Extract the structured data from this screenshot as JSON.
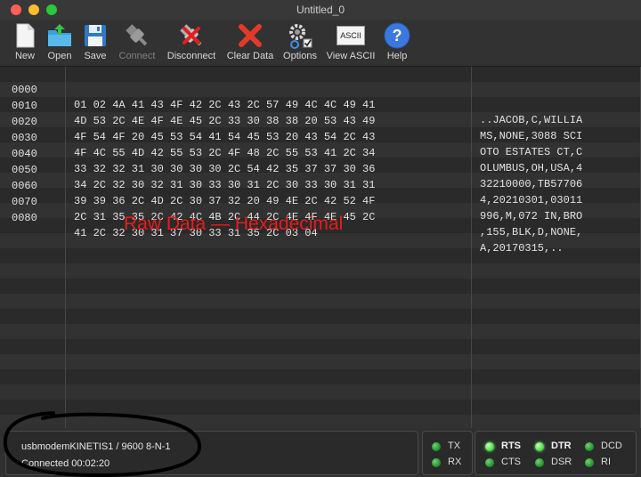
{
  "window": {
    "title": "Untitled_0"
  },
  "toolbar": {
    "new": "New",
    "open": "Open",
    "save": "Save",
    "connect": "Connect",
    "disconnect": "Disconnect",
    "clear": "Clear Data",
    "options": "Options",
    "view_ascii": "View ASCII",
    "view_ascii_icon_text": "ASCII",
    "help": "Help"
  },
  "data_rows": [
    {
      "offset": "0000",
      "hex": "01 02 4A 41 43 4F 42 2C 43 2C 57 49 4C 4C 49 41",
      "ascii": "..JACOB,C,WILLIA"
    },
    {
      "offset": "0010",
      "hex": "4D 53 2C 4E 4F 4E 45 2C 33 30 38 38 20 53 43 49",
      "ascii": "MS,NONE,3088 SCI"
    },
    {
      "offset": "0020",
      "hex": "4F 54 4F 20 45 53 54 41 54 45 53 20 43 54 2C 43",
      "ascii": "OTO ESTATES CT,C"
    },
    {
      "offset": "0030",
      "hex": "4F 4C 55 4D 42 55 53 2C 4F 48 2C 55 53 41 2C 34",
      "ascii": "OLUMBUS,OH,USA,4"
    },
    {
      "offset": "0040",
      "hex": "33 32 32 31 30 30 30 30 2C 54 42 35 37 37 30 36",
      "ascii": "32210000,TB57706"
    },
    {
      "offset": "0050",
      "hex": "34 2C 32 30 32 31 30 33 30 31 2C 30 33 30 31 31",
      "ascii": "4,20210301,03011"
    },
    {
      "offset": "0060",
      "hex": "39 39 36 2C 4D 2C 30 37 32 20 49 4E 2C 42 52 4F",
      "ascii": "996,M,072 IN,BRO"
    },
    {
      "offset": "0070",
      "hex": "2C 31 35 35 2C 42 4C 4B 2C 44 2C 4E 4F 4E 45 2C",
      "ascii": ",155,BLK,D,NONE,"
    },
    {
      "offset": "0080",
      "hex": "41 2C 32 30 31 37 30 33 31 35 2C 03 04",
      "ascii": "A,20170315,.."
    }
  ],
  "overlay_label": "Raw Data — Hexadecimal",
  "status": {
    "port_info": "usbmodemKINETIS1 / 9600 8-N-1",
    "connection": "Connected 00:02:20"
  },
  "leds": {
    "tx": "TX",
    "rx": "RX",
    "rts": "RTS",
    "dtr": "DTR",
    "dcd": "DCD",
    "cts": "CTS",
    "dsr": "DSR",
    "ri": "RI"
  },
  "colors": {
    "overlay_text": "#e81c1c",
    "led_on": "#3fd93f",
    "led_dim": "#1f8a2a"
  }
}
